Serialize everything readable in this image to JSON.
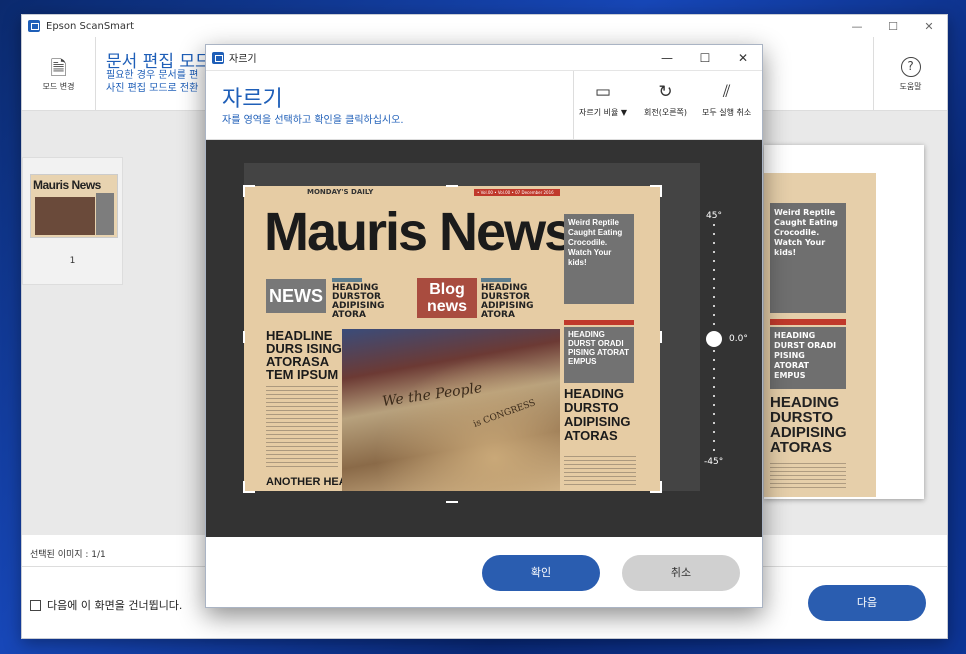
{
  "main_window": {
    "title": "Epson ScanSmart",
    "controls": {
      "minimize": "—",
      "maximize": "☐",
      "close": "✕"
    },
    "mode_button_label": "모드 변경",
    "page_title": "문서 편집 모드",
    "description_line1": "필요한 경우 문서를 편",
    "description_line2": "사진 편집 모드로 전환",
    "help_label": "도움말",
    "thumbnail": {
      "masthead": "Mauris News",
      "page_number": "1"
    },
    "preview": {
      "box1": "Weird Reptile Caught Eating Crocodile. Watch Your kids!",
      "box2": "HEADING DURST ORADI PISING ATORAT EMPUS",
      "headline": "HEADING DURSTO ADIPISING ATORAS"
    },
    "selected_images": "선택된 이미지 : 1/1",
    "skip_label": "다음에 이 화면을 건너뜁니다.",
    "next_button": "다음"
  },
  "crop_dialog": {
    "window_title": "자르기",
    "controls": {
      "minimize": "—",
      "maximize": "☐",
      "close": "✕"
    },
    "title": "자르기",
    "subtitle": "자를 영역을 선택하고 확인을 클릭하십시오.",
    "tools": {
      "aspect_ratio": "자르기 비율 ▼",
      "rotate": "회전(오른쪽)",
      "undo_all": "모두 실행 취소"
    },
    "rotation": {
      "max": "45°",
      "min": "-45°",
      "current": "0.0°"
    },
    "ok_button": "확인",
    "cancel_button": "취소"
  },
  "newspaper": {
    "daily": "MONDAY'S DAILY",
    "date": "• Vol.00 • Vol.00 • 07 December 2016",
    "masthead": "Mauris News",
    "news_box": "NEWS",
    "blog_box": "Blog news",
    "heading1": "HEADING DURSTOR ADIPISING ATORA",
    "heading2": "HEADING DURSTOR ADIPISING ATORA",
    "left_headline": "HEADLINE DURS ISING ATORASA TEM IPSUM",
    "another": "ANOTHER HEA",
    "photo_text1": "We the People",
    "photo_text2": "is CONGRESS",
    "right_box1": "Weird Reptile Caught Eating Crocodile. Watch Your kids!",
    "right_box2": "HEADING DURST ORADI PISING ATORAT EMPUS",
    "right_headline": "HEADING DURSTO ADIPISING ATORAS"
  }
}
